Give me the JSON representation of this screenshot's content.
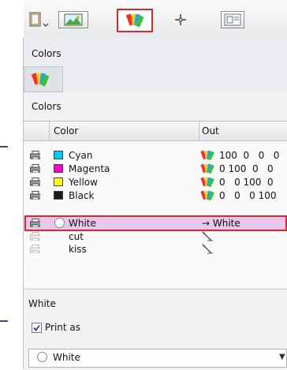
{
  "toolbar": {
    "buttons": [
      {
        "icon": "document-page-icon"
      },
      {
        "icon": "image-landscape-icon"
      },
      {
        "icon": "color-swatches-icon",
        "active": true
      },
      {
        "icon": "crosshair-icon"
      },
      {
        "icon": "layout-frame-icon"
      }
    ]
  },
  "section1": {
    "title": "Colors"
  },
  "section2": {
    "title": "Colors",
    "columns": [
      "Color",
      "Out"
    ],
    "rows": [
      {
        "name": "Cyan",
        "swatch": "#00c8f8",
        "out": "100  0   0   0"
      },
      {
        "name": "Magenta",
        "swatch": "#ff00cc",
        "out": "0 100  0   0"
      },
      {
        "name": "Yellow",
        "swatch": "#ffff00",
        "out": "0   0 100  0"
      },
      {
        "name": "Black",
        "swatch": "#1a1a1a",
        "out": "0   0   0 100"
      },
      {
        "name": "White",
        "swatch": "radio",
        "out": "→ White",
        "selected": true
      },
      {
        "name": "cut",
        "swatch": "none",
        "out": ""
      },
      {
        "name": "kiss",
        "swatch": "none",
        "out": ""
      }
    ]
  },
  "section3": {
    "title": "White",
    "print_as_label": "Print as",
    "print_as_checked": true,
    "dropdown_value": "White"
  },
  "colors": {
    "accent_red": "#e0252d",
    "selection": "#e9c7ea"
  }
}
